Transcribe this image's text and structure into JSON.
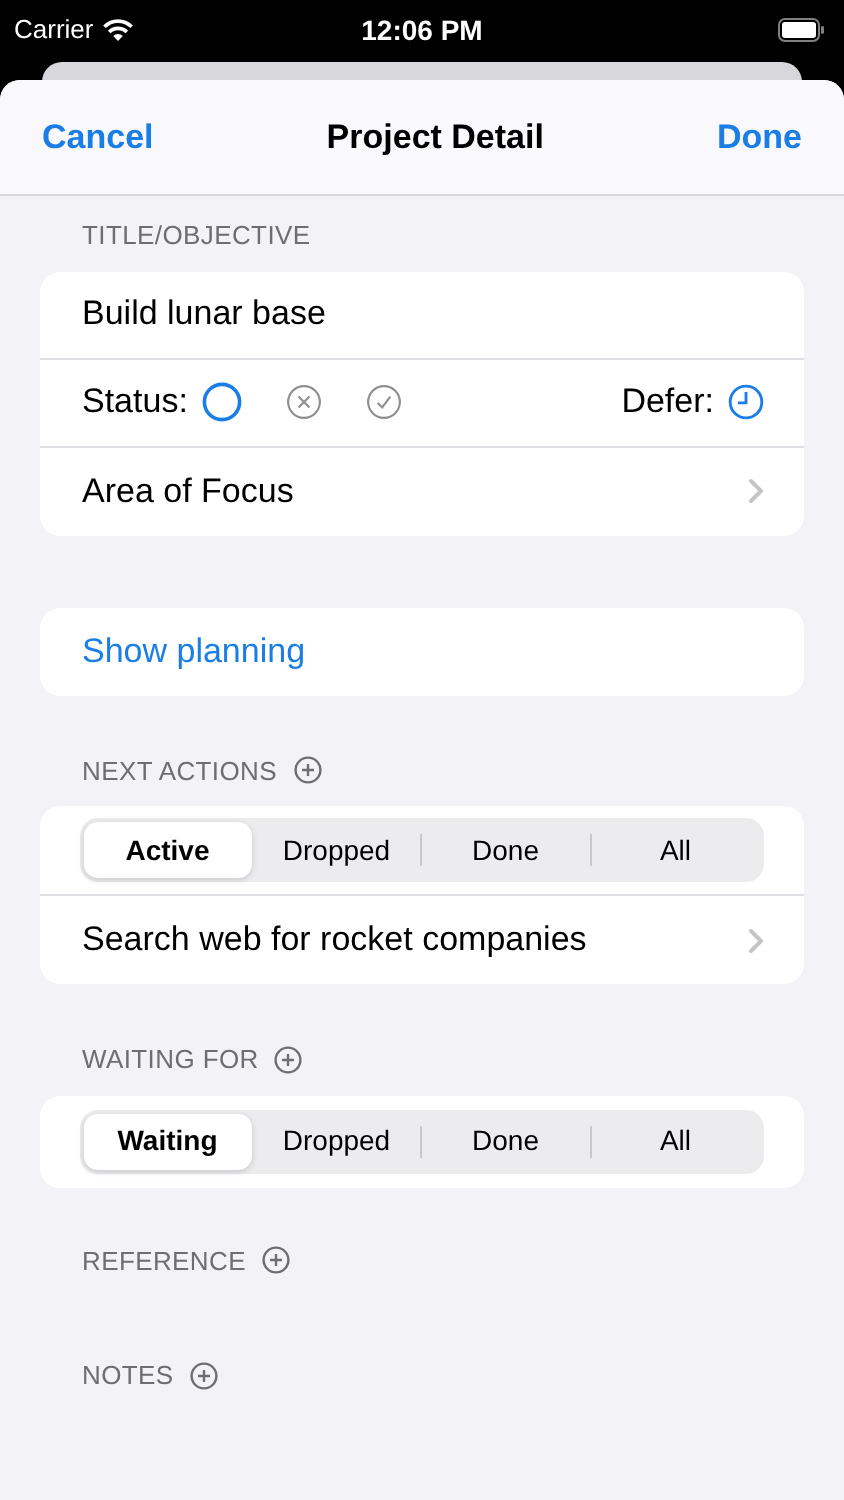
{
  "status_bar": {
    "carrier": "Carrier",
    "time": "12:06 PM"
  },
  "nav": {
    "cancel": "Cancel",
    "title": "Project Detail",
    "done": "Done"
  },
  "title_section": {
    "header": "TITLE/OBJECTIVE",
    "title": "Build lunar base",
    "status_label": "Status:",
    "status_options": [
      {
        "kind": "open",
        "selected": true
      },
      {
        "kind": "dropped",
        "selected": false
      },
      {
        "kind": "done",
        "selected": false
      }
    ],
    "defer_label": "Defer:",
    "area_of_focus": "Area of Focus"
  },
  "show_planning": "Show planning",
  "next_actions": {
    "header": "NEXT ACTIONS",
    "segments": [
      {
        "label": "Active",
        "selected": true
      },
      {
        "label": "Dropped",
        "selected": false
      },
      {
        "label": "Done",
        "selected": false
      },
      {
        "label": "All",
        "selected": false
      }
    ],
    "items": [
      "Search web for rocket companies"
    ]
  },
  "waiting_for": {
    "header": "WAITING FOR",
    "segments": [
      {
        "label": "Waiting",
        "selected": true
      },
      {
        "label": "Dropped",
        "selected": false
      },
      {
        "label": "Done",
        "selected": false
      },
      {
        "label": "All",
        "selected": false
      }
    ]
  },
  "reference": {
    "header": "REFERENCE"
  },
  "notes": {
    "header": "NOTES"
  }
}
